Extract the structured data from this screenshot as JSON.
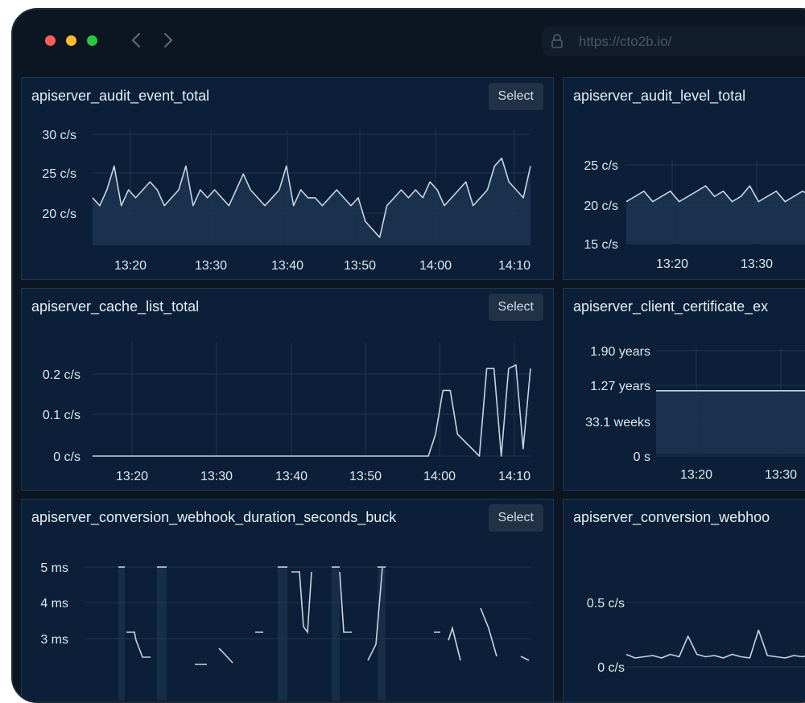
{
  "browser": {
    "url": "https://cto2b.io/",
    "buttons": [
      "close",
      "minimize",
      "maximize"
    ],
    "colors": {
      "close": "#fe5f57",
      "minimize": "#febc2e",
      "maximize": "#28c840"
    }
  },
  "panels": [
    {
      "title": "apiserver_audit_event_total",
      "select_label": "Select"
    },
    {
      "title": "apiserver_audit_level_total"
    },
    {
      "title": "apiserver_cache_list_total",
      "select_label": "Select"
    },
    {
      "title": "apiserver_client_certificate_ex"
    },
    {
      "title": "apiserver_conversion_webhook_duration_seconds_buck",
      "select_label": "Select"
    },
    {
      "title": "apiserver_conversion_webhoo"
    }
  ],
  "theme": {
    "line": "#c7d3e0",
    "fill": "#1c3550",
    "grid": "#1f3650",
    "panel_bg": "#0b2038"
  },
  "chart_data": [
    {
      "type": "area",
      "title": "apiserver_audit_event_total",
      "x_ticks": [
        "13:20",
        "13:30",
        "13:40",
        "13:50",
        "14:00",
        "14:10"
      ],
      "y_ticks": [
        "30 c/s",
        "25 c/s",
        "20 c/s"
      ],
      "x_range": [
        "13:12",
        "14:13"
      ],
      "ylim": [
        17,
        31
      ],
      "x": [
        "13:12",
        "13:13",
        "13:14",
        "13:15",
        "13:16",
        "13:17",
        "13:18",
        "13:19",
        "13:20",
        "13:21",
        "13:22",
        "13:23",
        "13:24",
        "13:25",
        "13:26",
        "13:27",
        "13:28",
        "13:29",
        "13:30",
        "13:31",
        "13:32",
        "13:33",
        "13:34",
        "13:35",
        "13:36",
        "13:37",
        "13:38",
        "13:39",
        "13:40",
        "13:41",
        "13:42",
        "13:43",
        "13:44",
        "13:45",
        "13:46",
        "13:47",
        "13:48",
        "13:49",
        "13:50",
        "13:51",
        "13:52",
        "13:53",
        "13:54",
        "13:55",
        "13:56",
        "13:57",
        "13:58",
        "13:59",
        "14:00",
        "14:01",
        "14:02",
        "14:03",
        "14:04",
        "14:05",
        "14:06",
        "14:07",
        "14:08",
        "14:09",
        "14:10",
        "14:11",
        "14:12",
        "14:13"
      ],
      "values": [
        23,
        22,
        24,
        27,
        22,
        24,
        23,
        24,
        25,
        24,
        22,
        23,
        24,
        27,
        22,
        24,
        23,
        24,
        23,
        22,
        24,
        26,
        24,
        23,
        22,
        23,
        24,
        27,
        22,
        24,
        23,
        23,
        22,
        23,
        24,
        23,
        22,
        23,
        20,
        19,
        18,
        22,
        23,
        24,
        23,
        24,
        23,
        25,
        24,
        22,
        23,
        24,
        25,
        22,
        23,
        24,
        27,
        28,
        25,
        24,
        23,
        27
      ],
      "grid": true
    },
    {
      "type": "area",
      "title": "apiserver_audit_level_total",
      "x_ticks": [
        "13:20",
        "13:30"
      ],
      "y_ticks": [
        "25 c/s",
        "20 c/s",
        "15 c/s"
      ],
      "x_range": [
        "13:12",
        "13:35"
      ],
      "ylim": [
        14,
        29
      ],
      "x": [
        "13:12",
        "13:13",
        "13:14",
        "13:15",
        "13:16",
        "13:17",
        "13:18",
        "13:19",
        "13:20",
        "13:21",
        "13:22",
        "13:23",
        "13:24",
        "13:25",
        "13:26",
        "13:27",
        "13:28",
        "13:29",
        "13:30",
        "13:31",
        "13:32",
        "13:33",
        "13:34",
        "13:35"
      ],
      "values": [
        22,
        23,
        24,
        22,
        23,
        24,
        22,
        23,
        24,
        25,
        23,
        24,
        22,
        23,
        25,
        22,
        23,
        24,
        22,
        23,
        24,
        23,
        25,
        22
      ],
      "grid": true
    },
    {
      "type": "line",
      "title": "apiserver_cache_list_total",
      "x_ticks": [
        "13:20",
        "13:30",
        "13:40",
        "13:50",
        "14:00",
        "14:10"
      ],
      "y_ticks": [
        "0.2 c/s",
        "0.1 c/s",
        "0 c/s"
      ],
      "x_range": [
        "13:12",
        "14:12"
      ],
      "ylim": [
        0,
        0.3
      ],
      "x": [
        "13:12",
        "13:58",
        "13:59",
        "14:00",
        "14:01",
        "14:02",
        "14:05",
        "14:06",
        "14:07",
        "14:08",
        "14:09",
        "14:10",
        "14:11",
        "14:12"
      ],
      "values": [
        0,
        0,
        0.06,
        0.18,
        0.18,
        0.06,
        0,
        0.24,
        0.24,
        0,
        0.24,
        0.25,
        0.02,
        0.24
      ],
      "grid": true
    },
    {
      "type": "line",
      "title": "apiserver_client_certificate_ex",
      "x_ticks": [
        "13:20",
        "13:30"
      ],
      "y_ticks": [
        "1.90 years",
        "1.27 years",
        "33.1 weeks",
        "0 s"
      ],
      "x_range": [
        "13:15",
        "13:35"
      ],
      "ylim": [
        0,
        2.1
      ],
      "x": [
        "13:15",
        "13:35"
      ],
      "values": [
        1.32,
        1.32
      ],
      "grid": true
    },
    {
      "type": "line",
      "title": "apiserver_conversion_webhook_duration_seconds_buck",
      "x_ticks": [],
      "y_ticks": [
        "5 ms",
        "4 ms",
        "3 ms"
      ],
      "x_range": [
        "13:12",
        "14:12"
      ],
      "ylim": [
        2,
        5.5
      ],
      "grid": true
    },
    {
      "type": "line",
      "title": "apiserver_conversion_webhoo",
      "x_ticks": [],
      "y_ticks": [
        "0.5 c/s",
        "0 c/s"
      ],
      "x_range": [
        "13:12",
        "13:35"
      ],
      "ylim": [
        0,
        0.8
      ],
      "x": [
        "13:12",
        "13:13",
        "13:14",
        "13:15",
        "13:16",
        "13:17",
        "13:18",
        "13:19",
        "13:20",
        "13:21",
        "13:22",
        "13:23",
        "13:24",
        "13:25",
        "13:26",
        "13:27",
        "13:28",
        "13:29",
        "13:30",
        "13:31",
        "13:32",
        "13:33",
        "13:34",
        "13:35"
      ],
      "values": [
        0.05,
        0.02,
        0.03,
        0.04,
        0.02,
        0.05,
        0.03,
        0.2,
        0.05,
        0.03,
        0.04,
        0.02,
        0.05,
        0.03,
        0.02,
        0.25,
        0.04,
        0.03,
        0.02,
        0.04,
        0.03,
        0.05,
        0.02,
        0.04
      ],
      "grid": true
    }
  ]
}
